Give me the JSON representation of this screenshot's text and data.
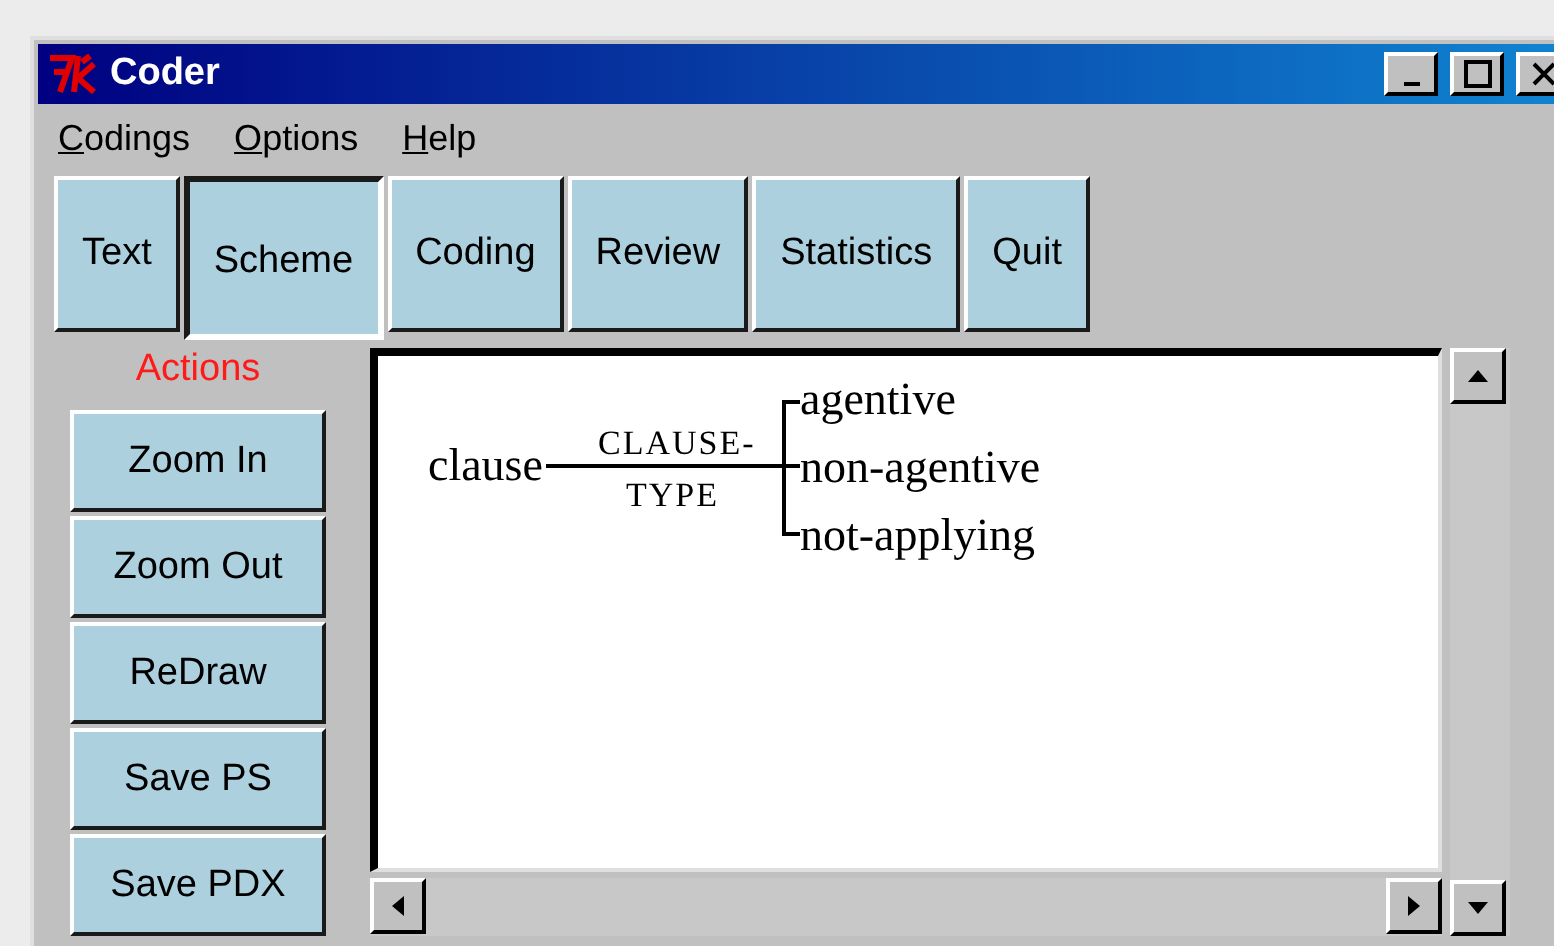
{
  "window": {
    "title": "Coder"
  },
  "menu": [
    "Codings",
    "Options",
    "Help"
  ],
  "tabs": [
    {
      "label": "Text",
      "selected": false
    },
    {
      "label": "Scheme",
      "selected": true
    },
    {
      "label": "Coding",
      "selected": false
    },
    {
      "label": "Review",
      "selected": false
    },
    {
      "label": "Statistics",
      "selected": false
    },
    {
      "label": "Quit",
      "selected": false
    }
  ],
  "actions": {
    "title": "Actions",
    "buttons": [
      "Zoom In",
      "Zoom Out",
      "ReDraw",
      "Save PS",
      "Save PDX"
    ]
  },
  "scheme": {
    "root": "clause",
    "feature_lines": [
      "CLAUSE-",
      "TYPE"
    ],
    "options": [
      "agentive",
      "non-agentive",
      "not-applying"
    ]
  }
}
